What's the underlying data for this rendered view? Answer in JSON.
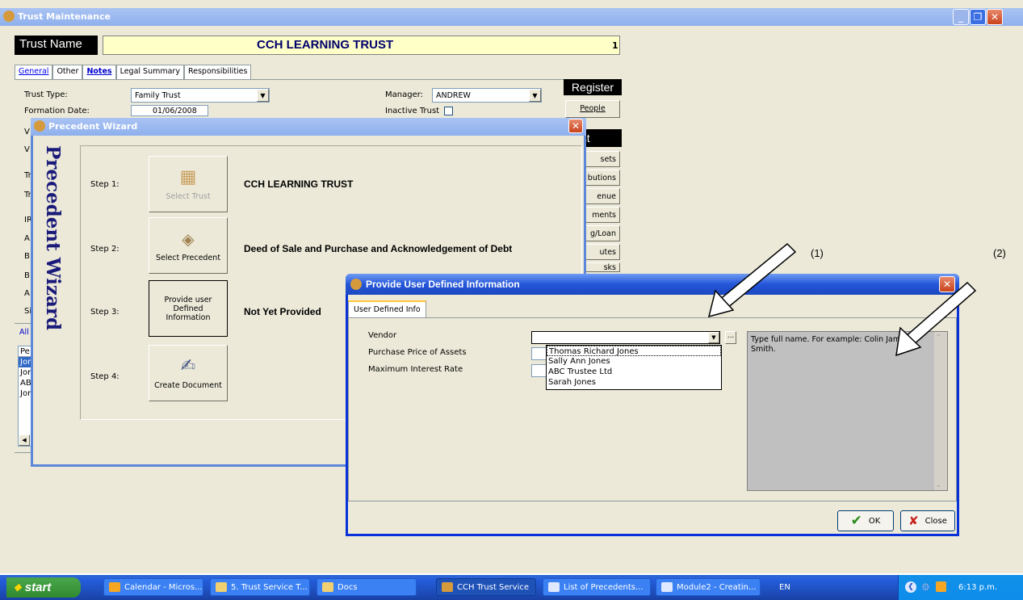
{
  "main_window": {
    "title": "Trust Maintenance",
    "trust_name_label": "Trust Name",
    "trust_name_value": "CCH LEARNING TRUST",
    "record_number": "1",
    "tabs": [
      "General",
      "Other",
      "Notes",
      "Legal Summary",
      "Responsibilities"
    ],
    "trust_type_label": "Trust Type:",
    "trust_type_value": "Family Trust",
    "formation_date_label": "Formation Date:",
    "formation_date_value": "01/06/2008",
    "manager_label": "Manager:",
    "manager_value": "ANDREW",
    "inactive_label": "Inactive Trust",
    "register_header": "Register",
    "people_button": "People",
    "trust_header": "ust",
    "side_buttons": [
      "sets",
      "butions",
      "enue",
      "ments",
      "g/Loan",
      "utes",
      "sks"
    ],
    "left_partial_labels": [
      "V",
      "V",
      "Tr",
      "Tr",
      "IR",
      "A",
      "B",
      "B",
      "A",
      "Si"
    ],
    "list_tab": "All",
    "list_items": [
      "Pe",
      "Jor",
      "Jor",
      "AB",
      "Jor"
    ]
  },
  "wizard": {
    "title": "Precedent Wizard",
    "banner": "Precedent Wizard",
    "steps": [
      {
        "label": "Step 1:",
        "button": "Select Trust",
        "value": "CCH LEARNING TRUST"
      },
      {
        "label": "Step 2:",
        "button": "Select Precedent",
        "value": "Deed of Sale and Purchase and Acknowledgement of Debt"
      },
      {
        "label": "Step 3:",
        "button": "Provide user Defined Information",
        "value": "Not Yet Provided"
      },
      {
        "label": "Step 4:",
        "button": "Create Document",
        "value": ""
      }
    ]
  },
  "dialog": {
    "title": "Provide User Defined Information",
    "tab": "User Defined Info",
    "fields": [
      "Vendor",
      "Purchase Price of Assets",
      "Maximum Interest Rate"
    ],
    "vendor_options": [
      "Thomas Richard Jones",
      "Sally Ann Jones",
      "ABC Trustee Ltd",
      "Sarah Jones"
    ],
    "help_text": "Type full name.  For example: Colin James Smith.",
    "ok_button": "OK",
    "close_button": "Close",
    "ellipsis": "..."
  },
  "annotations": [
    "(1)",
    "(2)"
  ],
  "taskbar": {
    "start": "start",
    "items": [
      "Calendar - Micros...",
      "5. Trust Service T...",
      "Docs",
      "CCH Trust Service",
      "List of Precedents...",
      "Module2 - Creatin..."
    ],
    "language": "EN",
    "clock": "6:13 p.m."
  },
  "colors": {
    "accent": "#2456d8",
    "trust_name_bg": "#ffffc8",
    "taskbar": "#245edb",
    "start": "#3c9a3c"
  }
}
